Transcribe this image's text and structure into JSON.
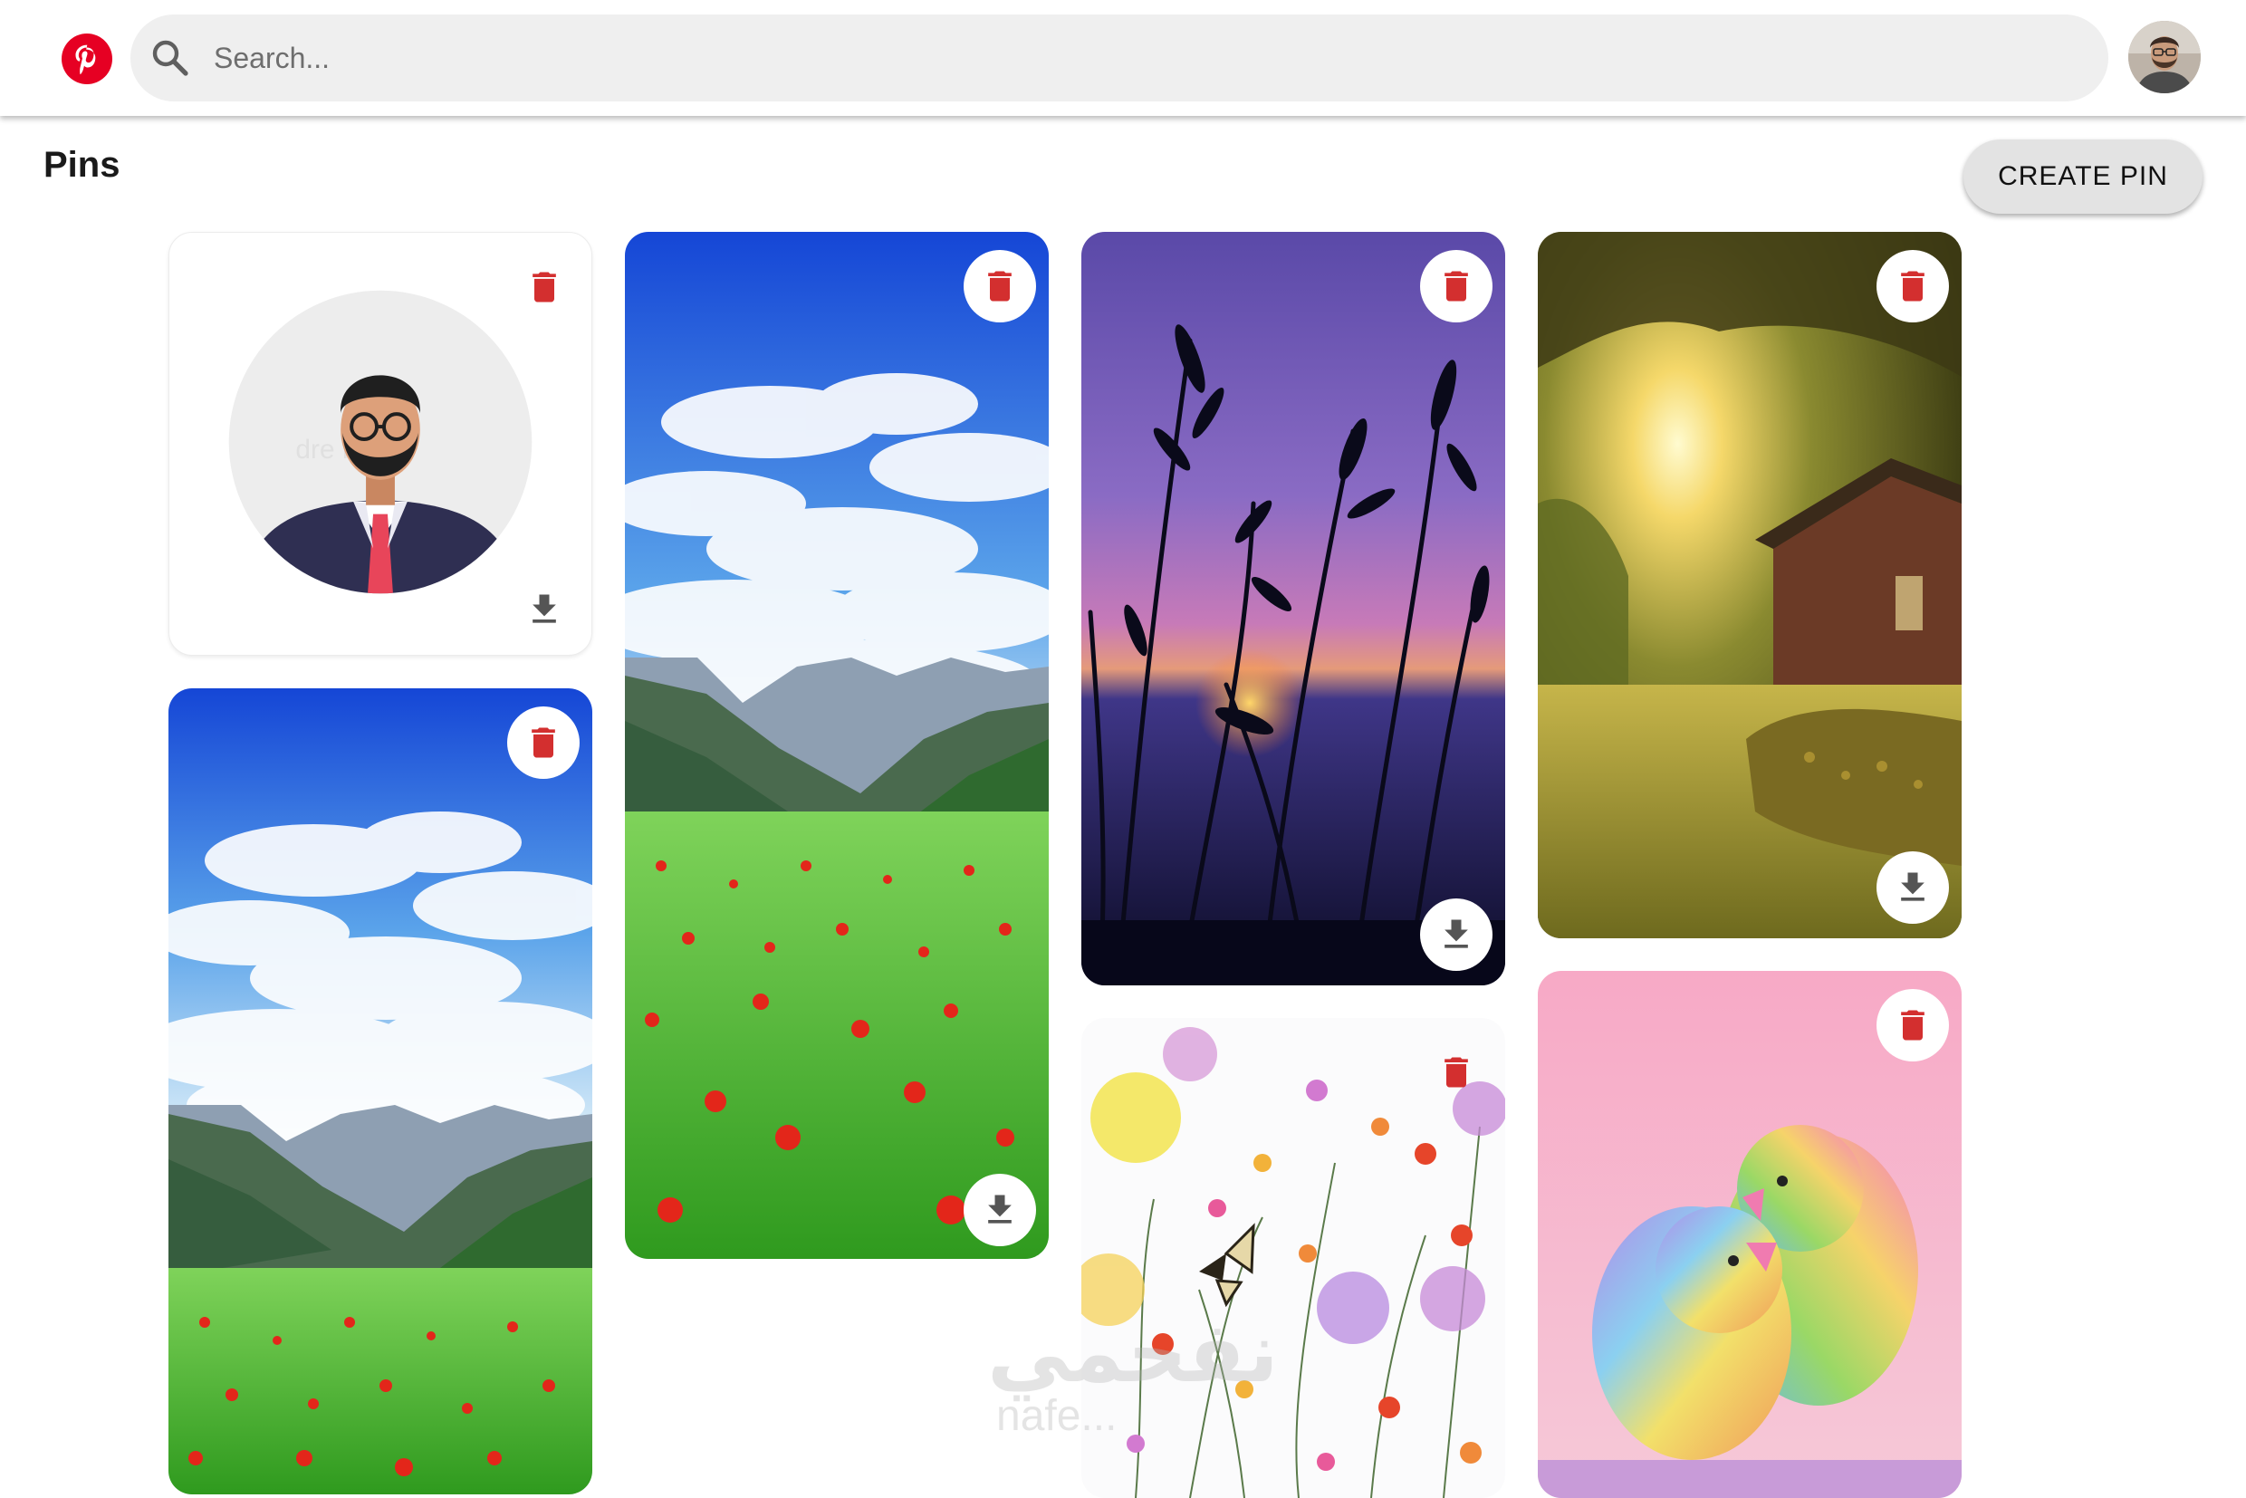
{
  "header": {
    "logo_icon": "pinterest-logo",
    "search_icon": "search-icon",
    "search_placeholder": "Search...",
    "search_value": "",
    "avatar_icon": "user-avatar"
  },
  "page": {
    "title": "Pins",
    "create_label": "CREATE PIN"
  },
  "pins": [
    {
      "id": "avatar-illustration",
      "scene": "businessman avatar illustration"
    },
    {
      "id": "mountain-valley-1",
      "scene": "mountain valley with poppy field"
    },
    {
      "id": "sunset-grass",
      "scene": "grass silhouette at purple sunset"
    },
    {
      "id": "forest-cabin",
      "scene": "sunlit forest with cabin"
    },
    {
      "id": "mountain-valley-2",
      "scene": "mountain valley with poppy field"
    },
    {
      "id": "wildflowers",
      "scene": "wildflowers with butterfly"
    },
    {
      "id": "rainbow-birds",
      "scene": "rainbow lovebirds on pink"
    }
  ],
  "icons": {
    "delete": "delete-icon",
    "download": "download-icon"
  },
  "colors": {
    "brand": "#e60023",
    "delete_icon": "#d32f2f",
    "download_icon": "#555555"
  },
  "watermark": {
    "arabic": "نفحمي",
    "latin": "nafe..."
  }
}
